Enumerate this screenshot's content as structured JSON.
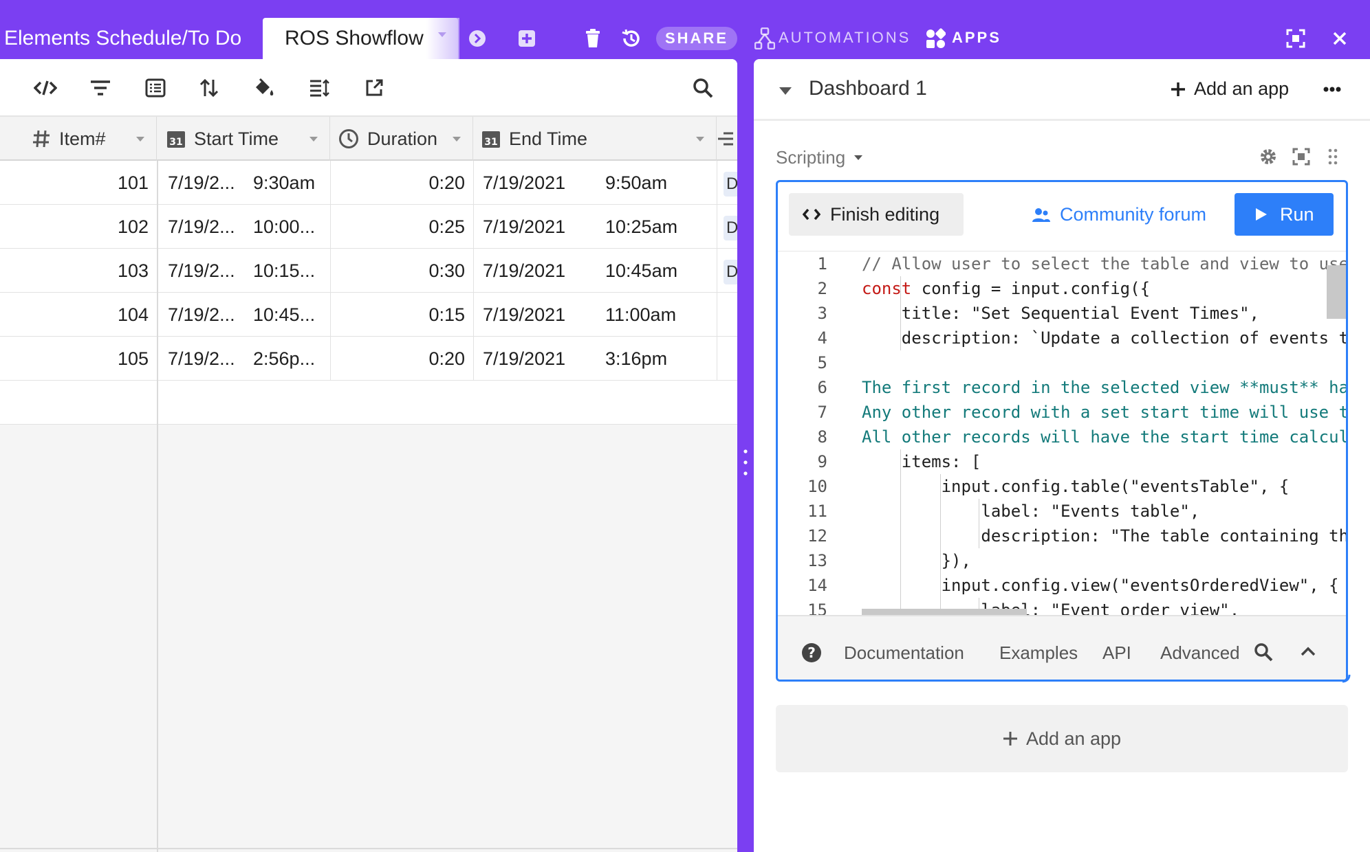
{
  "topbar": {
    "tabs": [
      "Elements Schedule/To Do",
      "ROS Showflow"
    ],
    "share_label": "SHARE",
    "automations_label": "AUTOMATIONS",
    "apps_label": "APPS"
  },
  "grid": {
    "columns": [
      {
        "label": "Item#",
        "icon": "number-icon"
      },
      {
        "label": "Start Time",
        "icon": "calendar-icon"
      },
      {
        "label": "Duration",
        "icon": "clock-icon"
      },
      {
        "label": "End Time",
        "icon": "calendar-icon"
      }
    ],
    "rows": [
      {
        "item": "101",
        "start_date": "7/19/2...",
        "start_time": "9:30am",
        "duration": "0:20",
        "end_date": "7/19/2021",
        "end_time": "9:50am",
        "extra": "D"
      },
      {
        "item": "102",
        "start_date": "7/19/2...",
        "start_time": "10:00...",
        "duration": "0:25",
        "end_date": "7/19/2021",
        "end_time": "10:25am",
        "extra": "D"
      },
      {
        "item": "103",
        "start_date": "7/19/2...",
        "start_time": "10:15...",
        "duration": "0:30",
        "end_date": "7/19/2021",
        "end_time": "10:45am",
        "extra": "D"
      },
      {
        "item": "104",
        "start_date": "7/19/2...",
        "start_time": "10:45...",
        "duration": "0:15",
        "end_date": "7/19/2021",
        "end_time": "11:00am",
        "extra": ""
      },
      {
        "item": "105",
        "start_date": "7/19/2...",
        "start_time": "2:56p...",
        "duration": "0:20",
        "end_date": "7/19/2021",
        "end_time": "3:16pm",
        "extra": ""
      }
    ]
  },
  "dashboard": {
    "title": "Dashboard 1",
    "add_app_label": "Add an app",
    "app_type": "Scripting",
    "finish_editing_label": "Finish editing",
    "community_forum_label": "Community forum",
    "run_label": "Run",
    "footer_links": [
      "Documentation",
      "Examples",
      "API",
      "Advanced"
    ],
    "add_app_card_label": "Add an app"
  },
  "code": {
    "lines": [
      {
        "n": "1",
        "text": "// Allow user to select the table and view to use"
      },
      {
        "n": "2",
        "text": "const config = input.config({"
      },
      {
        "n": "3",
        "text": "    title: \"Set Sequential Event Times\","
      },
      {
        "n": "4",
        "text": "    description: `Update a collection of events t"
      },
      {
        "n": "5",
        "text": ""
      },
      {
        "n": "6",
        "text": "The first record in the selected view **must** ha"
      },
      {
        "n": "7",
        "text": "Any other record with a set start time will use t"
      },
      {
        "n": "8",
        "text": "All other records will have the start time calcul"
      },
      {
        "n": "9",
        "text": "    items: ["
      },
      {
        "n": "10",
        "text": "        input.config.table(\"eventsTable\", {"
      },
      {
        "n": "11",
        "text": "            label: \"Events table\","
      },
      {
        "n": "12",
        "text": "            description: \"The table containing th"
      },
      {
        "n": "13",
        "text": "        }),"
      },
      {
        "n": "14",
        "text": "        input.config.view(\"eventsOrderedView\", {"
      },
      {
        "n": "15",
        "text": "            label: \"Event order view\","
      }
    ]
  },
  "colors": {
    "brand_purple": "#7b3ff2",
    "accent_blue": "#2d7ff9",
    "code_keyword": "#c41a16",
    "code_string": "#137a7a",
    "code_comment": "#6a6a6a"
  }
}
